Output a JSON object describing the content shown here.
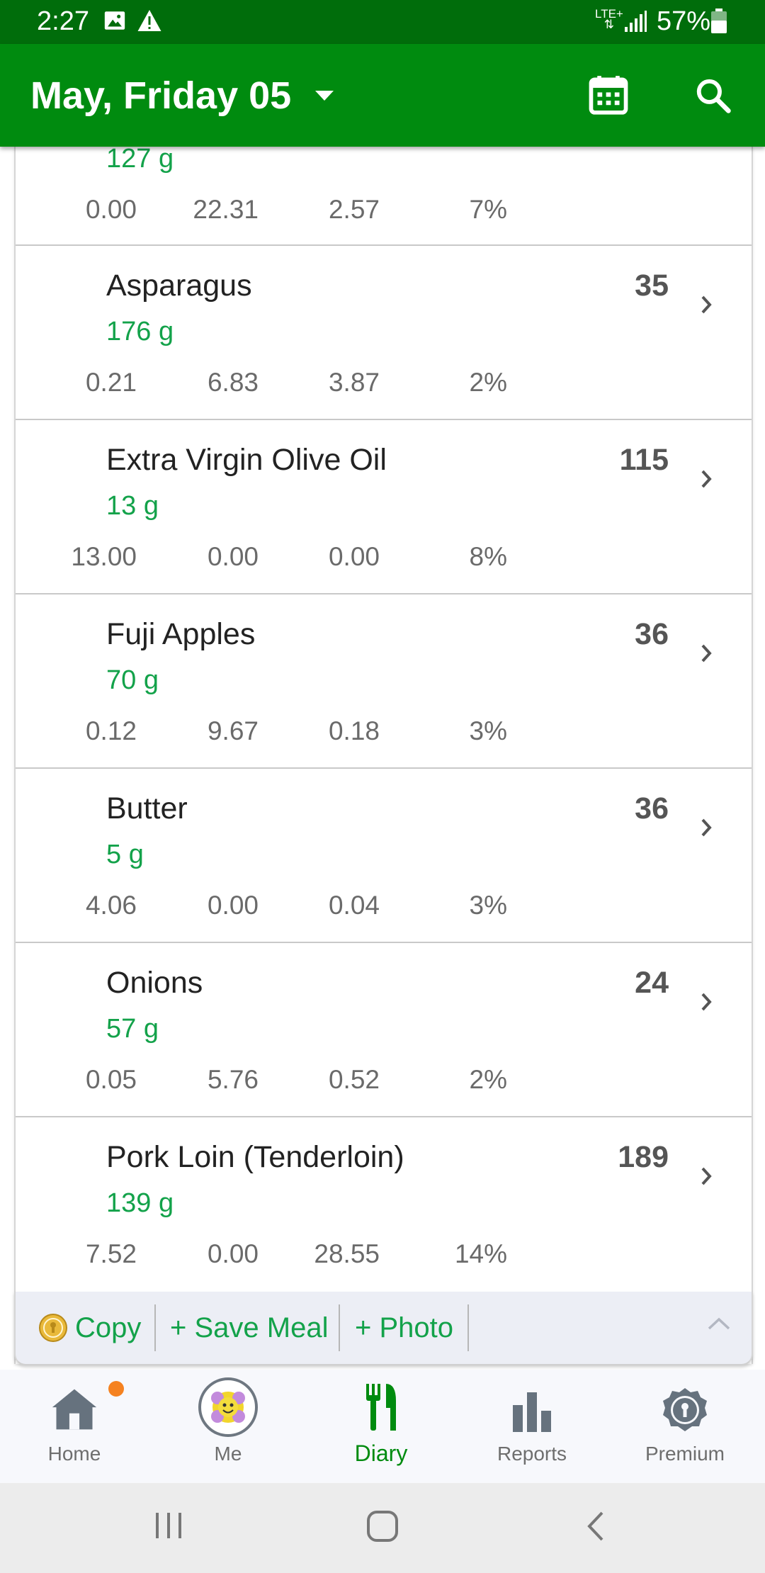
{
  "status_bar": {
    "time": "2:27",
    "network_label_top": "LTE+",
    "battery_pct": "57%"
  },
  "header": {
    "date_title": "May, Friday 05"
  },
  "top_partial": {
    "weight": "127 g",
    "n1": "0.00",
    "n2": "22.31",
    "n3": "2.57",
    "n4": "7%"
  },
  "foods": [
    {
      "name": "Asparagus",
      "calories": "35",
      "weight": "176 g",
      "n1": "0.21",
      "n2": "6.83",
      "n3": "3.87",
      "n4": "2%"
    },
    {
      "name": "Extra Virgin Olive Oil",
      "calories": "115",
      "weight": "13 g",
      "n1": "13.00",
      "n2": "0.00",
      "n3": "0.00",
      "n4": "8%"
    },
    {
      "name": "Fuji Apples",
      "calories": "36",
      "weight": "70 g",
      "n1": "0.12",
      "n2": "9.67",
      "n3": "0.18",
      "n4": "3%"
    },
    {
      "name": "Butter",
      "calories": "36",
      "weight": "5 g",
      "n1": "4.06",
      "n2": "0.00",
      "n3": "0.04",
      "n4": "3%"
    },
    {
      "name": "Onions",
      "calories": "24",
      "weight": "57 g",
      "n1": "0.05",
      "n2": "5.76",
      "n3": "0.52",
      "n4": "2%"
    },
    {
      "name": "Pork Loin (Tenderloin)",
      "calories": "189",
      "weight": "139 g",
      "n1": "7.52",
      "n2": "0.00",
      "n3": "28.55",
      "n4": "14%"
    }
  ],
  "actions": {
    "copy": "Copy",
    "save_meal": "+ Save Meal",
    "photo": "+ Photo"
  },
  "nav": {
    "home": "Home",
    "me": "Me",
    "diary": "Diary",
    "reports": "Reports",
    "premium": "Premium"
  },
  "colors": {
    "status_bar": "#006d0b",
    "app_bar": "#008b0f",
    "weight_text": "#13a24a",
    "notification_dot": "#f58220"
  }
}
